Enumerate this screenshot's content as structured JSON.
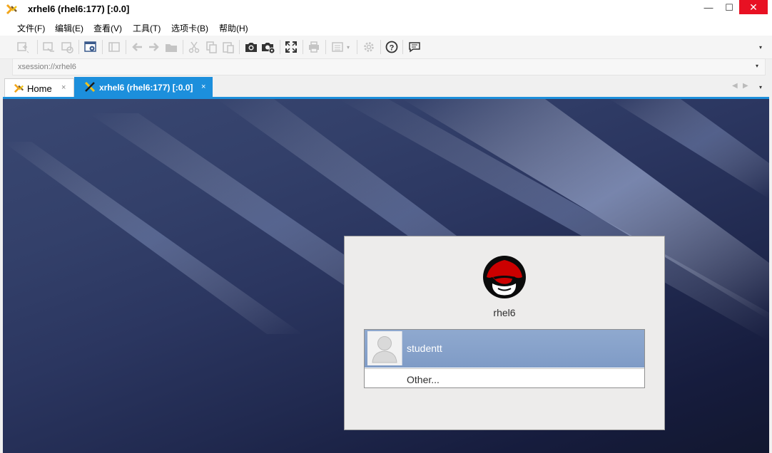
{
  "window": {
    "title": "xrhel6 (rhel6:177)  [:0.0]",
    "controls": {
      "minimize": "—",
      "maximize": "☐",
      "close": "✕"
    }
  },
  "menu": [
    {
      "label": "文件(F)"
    },
    {
      "label": "编辑(E)"
    },
    {
      "label": "查看(V)"
    },
    {
      "label": "工具(T)"
    },
    {
      "label": "选项卡(B)"
    },
    {
      "label": "帮助(H)"
    }
  ],
  "toolbar": {
    "icons": [
      "new-session-icon",
      "reconnect-icon",
      "disconnect-icon",
      "session-manager-icon",
      "panel-icon",
      "back-icon",
      "forward-icon",
      "folder-icon",
      "cut-icon",
      "copy-icon",
      "paste-icon",
      "camera-icon",
      "camera-settings-icon",
      "fullscreen-icon",
      "print-icon",
      "layout-icon",
      "gear-icon",
      "help-icon",
      "chat-icon"
    ],
    "more": "▾"
  },
  "address": {
    "value": "xsession://xrhel6",
    "dropdown": "▾"
  },
  "tabs": {
    "home": {
      "label": "Home",
      "close": "×"
    },
    "active": {
      "label": "xrhel6 (rhel6:177)  [:0.0]",
      "close": "×"
    },
    "scroll_left": "◀",
    "scroll_right": "▶",
    "list": "▾"
  },
  "login": {
    "hostname": "rhel6",
    "users": [
      {
        "name": "studentt"
      }
    ],
    "other": "Other..."
  },
  "colors": {
    "accent": "#1c8fdc",
    "close_red": "#e81123",
    "selected_row": "#86a1cb",
    "redhat_red": "#cc0000"
  }
}
